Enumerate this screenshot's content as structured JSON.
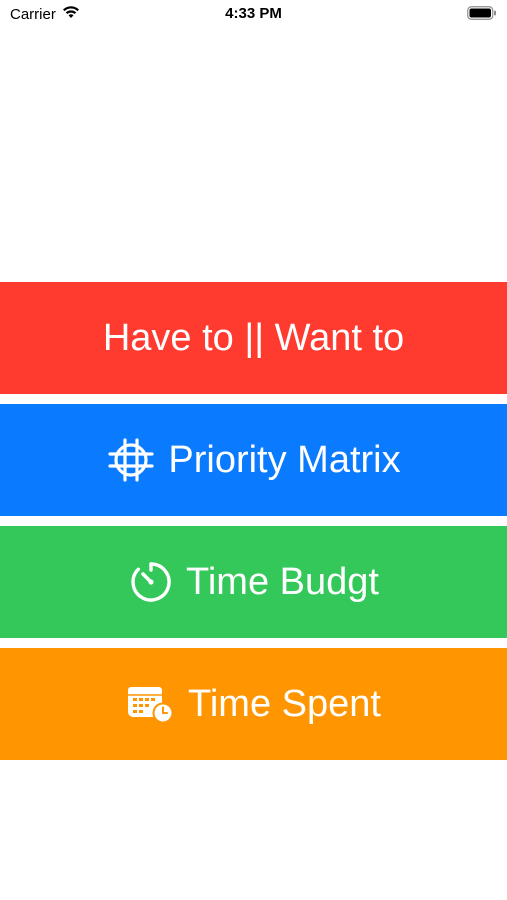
{
  "status_bar": {
    "carrier": "Carrier",
    "time": "4:33 PM"
  },
  "menu": {
    "items": [
      {
        "label": "Have to || Want to",
        "color": "#FF3B30",
        "icon": null
      },
      {
        "label": "Priority Matrix",
        "color": "#0A7AFF",
        "icon": "crosshair-grid-icon"
      },
      {
        "label": "Time Budgt",
        "color": "#34C759",
        "icon": "timer-icon"
      },
      {
        "label": "Time Spent",
        "color": "#FF9500",
        "icon": "calendar-clock-icon"
      }
    ]
  }
}
